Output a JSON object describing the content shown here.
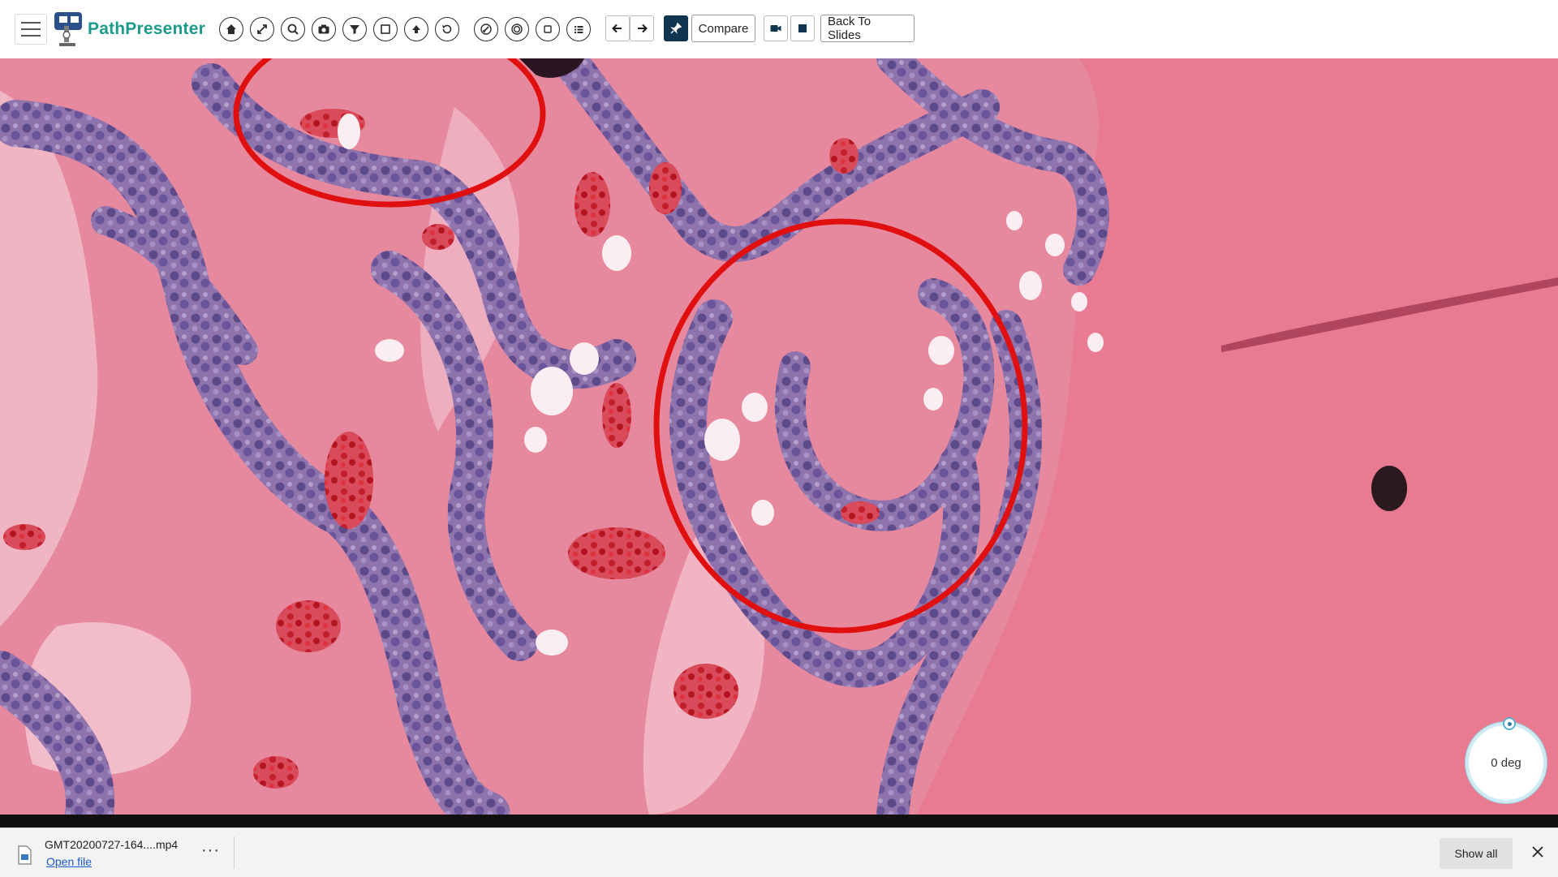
{
  "app": {
    "logo_text": "PathPresenter",
    "brand_color": "#1c9a8a"
  },
  "toolbar": {
    "icons": [
      "home-icon",
      "expand-icon",
      "zoom-icon",
      "camera-icon",
      "filter-icon",
      "layers-icon",
      "upload-icon",
      "history-icon",
      "annotation-icon",
      "target-icon",
      "square-icon",
      "list-icon"
    ],
    "prev_icon": "arrow-left-icon",
    "next_icon": "arrow-right-icon",
    "pin_icon": "pin-icon",
    "compare_label": "Compare",
    "record_icon": "video-camera-icon",
    "stop_icon": "stop-icon",
    "back_label": "Back To Slides"
  },
  "viewer": {
    "rotation_label": "0 deg",
    "annotation_color": "#e01010"
  },
  "download_bar": {
    "file_name": "GMT20200727-164....mp4",
    "open_label": "Open file",
    "more_label": "···",
    "show_all_label": "Show all"
  }
}
